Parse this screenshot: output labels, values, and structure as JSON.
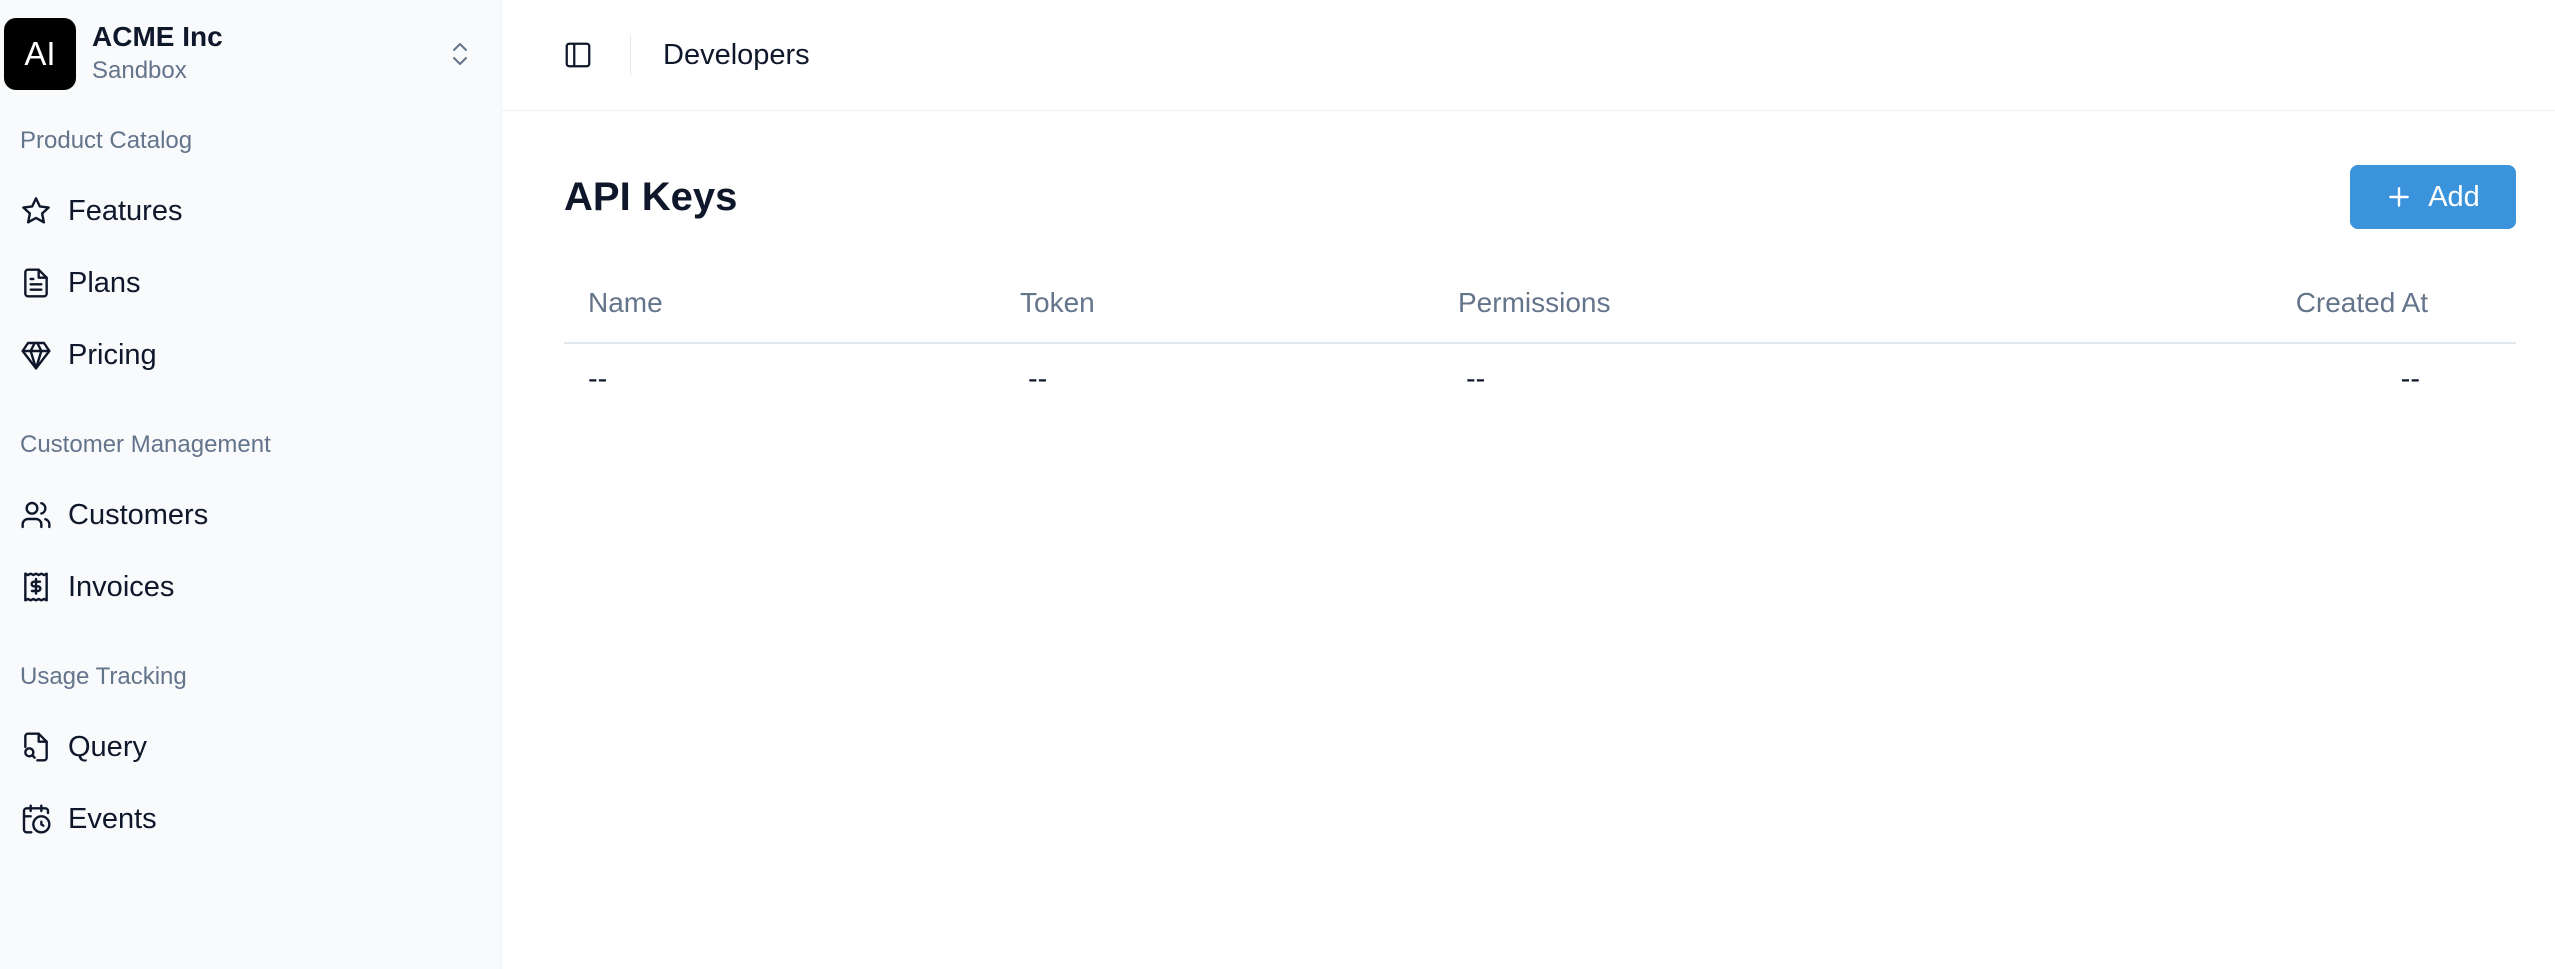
{
  "org": {
    "logo_text": "AI",
    "name": "ACME Inc",
    "environment": "Sandbox"
  },
  "sidebar": {
    "sections": [
      {
        "label": "Product Catalog",
        "items": [
          {
            "label": "Features",
            "icon": "star-icon"
          },
          {
            "label": "Plans",
            "icon": "document-icon"
          },
          {
            "label": "Pricing",
            "icon": "gem-icon"
          }
        ]
      },
      {
        "label": "Customer Management",
        "items": [
          {
            "label": "Customers",
            "icon": "users-icon"
          },
          {
            "label": "Invoices",
            "icon": "receipt-icon"
          }
        ]
      },
      {
        "label": "Usage Tracking",
        "items": [
          {
            "label": "Query",
            "icon": "file-search-icon"
          },
          {
            "label": "Events",
            "icon": "calendar-clock-icon"
          }
        ]
      }
    ]
  },
  "header": {
    "breadcrumb": "Developers"
  },
  "main": {
    "title": "API Keys",
    "add_label": "Add",
    "table": {
      "columns": [
        "Name",
        "Token",
        "Permissions",
        "Created At"
      ],
      "rows": [
        [
          "--",
          "--",
          "--",
          "--"
        ]
      ]
    }
  },
  "colors": {
    "accent": "#3a93db",
    "sidebar_bg": "#f8fafc",
    "muted_text": "#64748b"
  }
}
